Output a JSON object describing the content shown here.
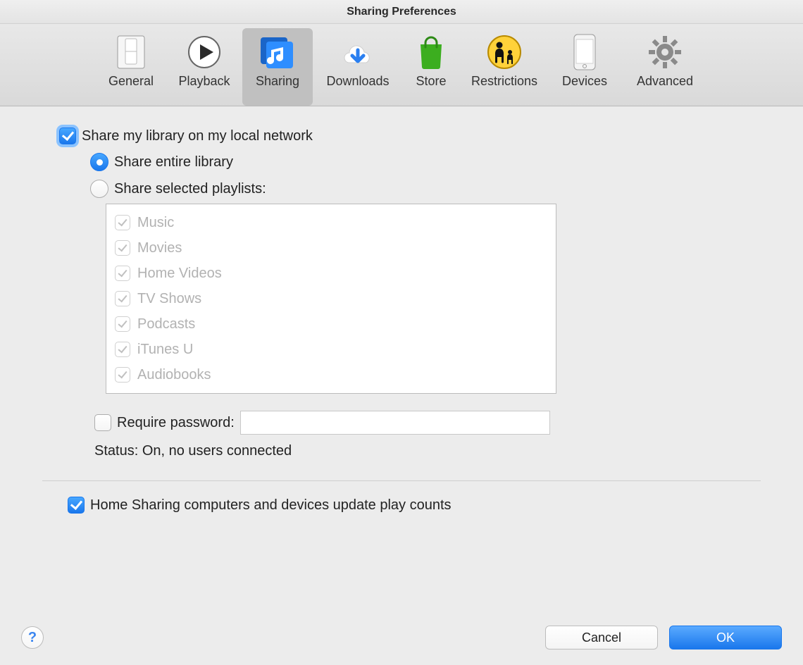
{
  "window": {
    "title": "Sharing Preferences"
  },
  "toolbar": {
    "items": [
      {
        "label": "General"
      },
      {
        "label": "Playback"
      },
      {
        "label": "Sharing"
      },
      {
        "label": "Downloads"
      },
      {
        "label": "Store"
      },
      {
        "label": "Restrictions"
      },
      {
        "label": "Devices"
      },
      {
        "label": "Advanced"
      }
    ],
    "selected_index": 2
  },
  "main": {
    "share_library_label": "Share my library on my local network",
    "share_library_checked": true,
    "share_option_entire_label": "Share entire library",
    "share_option_selected_label": "Share selected playlists:",
    "share_option_value": "entire",
    "playlists": [
      {
        "label": "Music",
        "checked": true
      },
      {
        "label": "Movies",
        "checked": true
      },
      {
        "label": "Home Videos",
        "checked": true
      },
      {
        "label": "TV Shows",
        "checked": true
      },
      {
        "label": "Podcasts",
        "checked": true
      },
      {
        "label": "iTunes U",
        "checked": true
      },
      {
        "label": "Audiobooks",
        "checked": true
      }
    ],
    "require_password_label": "Require password:",
    "require_password_checked": false,
    "password_value": "",
    "status_label": "Status: On, no users connected",
    "home_sharing_label": "Home Sharing computers and devices update play counts",
    "home_sharing_checked": true
  },
  "footer": {
    "cancel_label": "Cancel",
    "ok_label": "OK"
  }
}
